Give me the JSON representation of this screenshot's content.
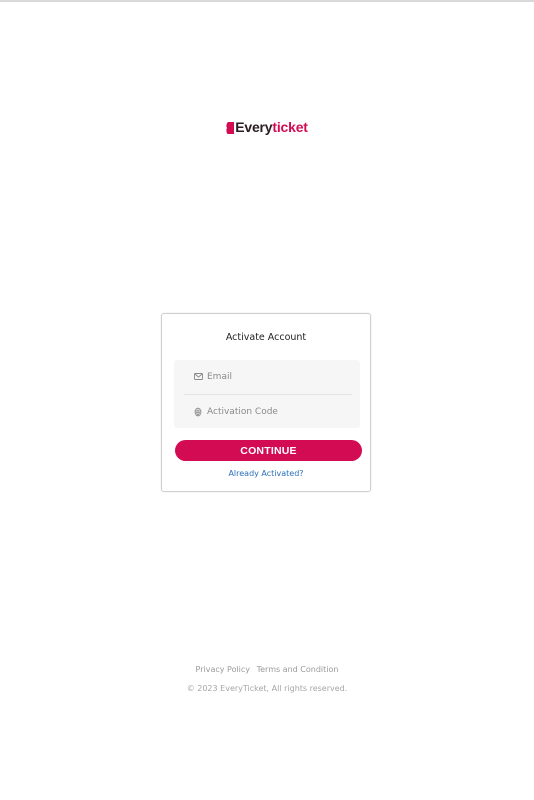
{
  "logo": {
    "part1": "Every",
    "part2": "ticket",
    "brand_color": "#d20b52",
    "dark_color": "#2a1c22"
  },
  "form": {
    "title": "Activate Account",
    "email": {
      "placeholder": "Email",
      "value": "",
      "icon": "mail-icon"
    },
    "code": {
      "placeholder": "Activation Code",
      "value": "",
      "icon": "fingerprint-icon"
    },
    "continue_label": "CONTINUE",
    "already_link": "Already Activated?"
  },
  "footer": {
    "privacy": "Privacy Policy",
    "terms": "Terms and Condition",
    "copyright": "© 2023 EveryTicket, All rights reserved."
  }
}
